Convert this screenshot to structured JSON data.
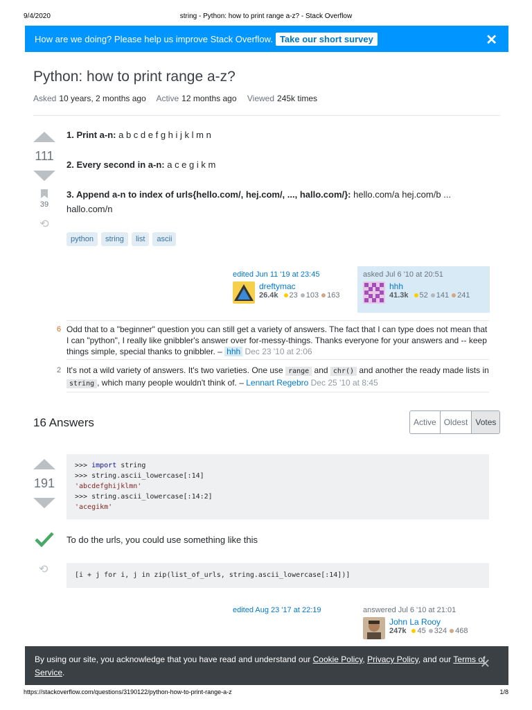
{
  "print": {
    "date": "9/4/2020",
    "title": "string - Python: how to print range a-z? - Stack Overflow",
    "url": "https://stackoverflow.com/questions/3190122/python-how-to-print-range-a-z",
    "page": "1/8"
  },
  "banner": {
    "message": "How are we doing? Please help us improve Stack Overflow.",
    "survey_label": "Take our short survey",
    "close": "✕"
  },
  "question": {
    "title": "Python: how to print range a-z?",
    "meta": {
      "asked_label": "Asked",
      "asked_value": "10 years, 2 months ago",
      "active_label": "Active",
      "active_value": "12 months ago",
      "viewed_label": "Viewed",
      "viewed_value": "245k times"
    },
    "votes": "111",
    "favorites": "39",
    "body": [
      {
        "bold": "1. Print a-n:",
        "text": " a b c d e f g h i j k l m n"
      },
      {
        "bold": "2. Every second in a-n:",
        "text": " a c e g i k m"
      },
      {
        "bold": "3. Append a-n to index of urls{hello.com/, hej.com/, ..., hallo.com/}:",
        "text": " hello.com/a hej.com/b ... hallo.com/n"
      }
    ],
    "tags": [
      "python",
      "string",
      "list",
      "ascii"
    ],
    "edited": {
      "label": "edited Jun 11 '19 at 23:45",
      "user": "dreftymac",
      "rep": "26.4k",
      "gold": "23",
      "silver": "103",
      "bronze": "163"
    },
    "asked": {
      "label": "asked Jul 6 '10 at 20:51",
      "user": "hhh",
      "rep": "41.3k",
      "gold": "52",
      "silver": "141",
      "bronze": "241"
    },
    "comments": [
      {
        "score": "6",
        "text": "Odd that to a \"beginner\" question you can still get a variety of answers. The fact that I can type does not mean that I can \"python\", I really like gnibbler's answer over for-messy-things. Thanks everyone for your answers and -- keep things simple, special thanks to gnibbler. –",
        "user": "hhh",
        "date": "Dec 23 '10 at 2:06"
      },
      {
        "score": "2",
        "pre": "It's not a wild variety of answers. It's two varieties. One use",
        "code1": "range",
        "mid1": "and",
        "code2": "chr()",
        "mid2": "and another the ready made lists in",
        "code3": "string",
        "post": ", which many people wouldn't think of. –",
        "user": "Lennart Regebro",
        "date": "Dec 25 '10 at 8:45"
      }
    ]
  },
  "answers": {
    "heading": "16 Answers",
    "sort": [
      "Active",
      "Oldest",
      "Votes"
    ],
    "first": {
      "votes": "191",
      "code1": [
        ">>> import string",
        ">>> string.ascii_lowercase[:14]",
        "'abcdefghijklmn'",
        ">>> string.ascii_lowercase[:14:2]",
        "'acegikm'"
      ],
      "text": "To do the urls, you could use something like this",
      "code2": "[i + j for i, j in zip(list_of_urls, string.ascii_lowercase[:14])]",
      "edited": "edited Aug 23 '17 at 22:19",
      "answered": "answered Jul 6 '10 at 21:01",
      "user": "John La Rooy",
      "rep": "247k",
      "gold": "45",
      "silver": "324",
      "bronze": "468"
    }
  },
  "cookie": {
    "pre": "By using our site, you acknowledge that you have read and understand our",
    "cookie_policy": "Cookie Policy",
    "privacy_policy": "Privacy Policy",
    "and": ", and our",
    "terms": "Terms of Service",
    "close": "✕"
  }
}
